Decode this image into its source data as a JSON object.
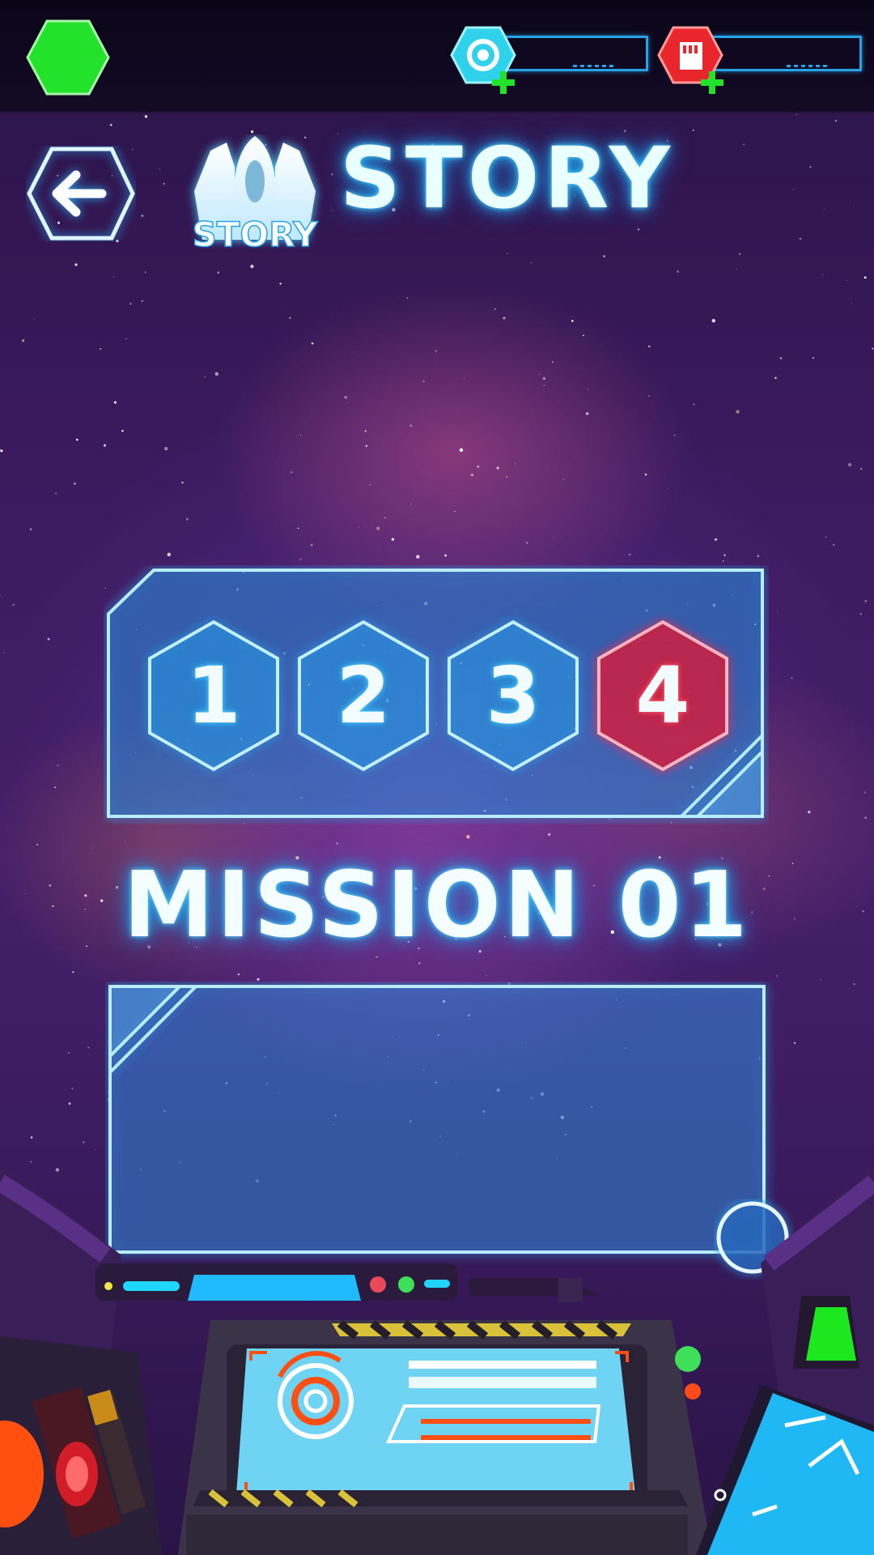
{
  "header": {
    "title": "STORY",
    "logo_caption": "STORY"
  },
  "resources": [
    {
      "name": "energy",
      "icon": "target-icon",
      "color": "#2fd2ea",
      "value": ""
    },
    {
      "name": "cards",
      "icon": "card-icon",
      "color": "#e8262c",
      "value": ""
    }
  ],
  "chapters": [
    {
      "label": "1",
      "active": false
    },
    {
      "label": "2",
      "active": false
    },
    {
      "label": "3",
      "active": false
    },
    {
      "label": "4",
      "active": true
    }
  ],
  "mission": {
    "title": "MISSION 01"
  },
  "colors": {
    "accent": "#27a3e8",
    "active_chapter": "#e0203a",
    "status_green": "#22e22a",
    "topbar": "#0d0820"
  }
}
